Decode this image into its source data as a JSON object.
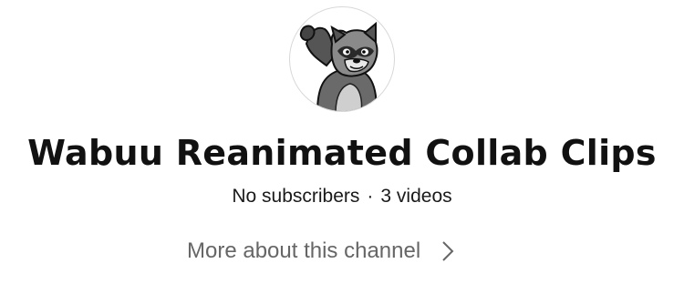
{
  "channel": {
    "name": "Wabuu Reanimated Collab Clips",
    "subscribers": "No subscribers",
    "separator": "·",
    "videos": "3 videos",
    "more_about_label": "More about this channel"
  },
  "icons": {
    "avatar": "raccoon-avatar",
    "more_about": "chevron-right-icon"
  },
  "colors": {
    "title": "#111111",
    "stats": "#1a1a1a",
    "link": "#666666"
  }
}
